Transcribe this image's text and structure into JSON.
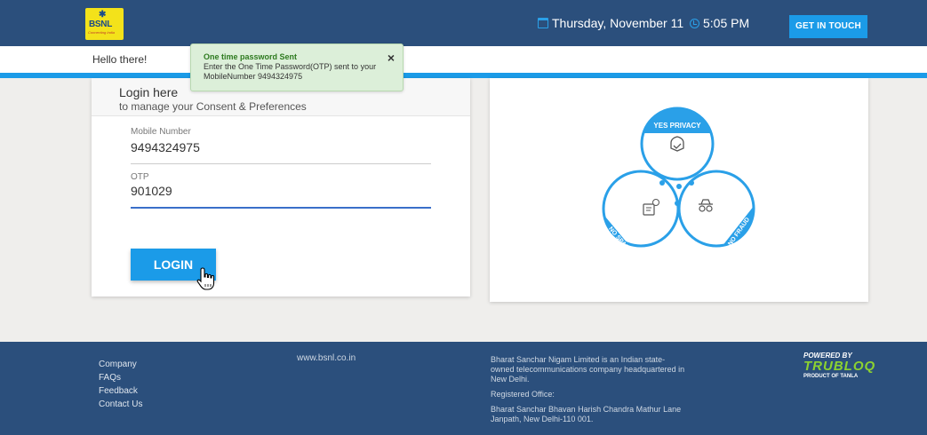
{
  "header": {
    "brand": "BSNL",
    "brand_tagline": "Connecting India",
    "date": "Thursday, November 11",
    "time": "5:05 PM",
    "cta_label": "GET IN TOUCH"
  },
  "greeting": "Hello there!",
  "toast": {
    "title": "One time password Sent",
    "message": "Enter the One Time Password(OTP) sent to your MobileNumber 9494324975",
    "close": "×"
  },
  "login": {
    "title": "Login here",
    "subtitle": "to manage your Consent & Preferences",
    "mobile_label": "Mobile Number",
    "mobile_value": "9494324975",
    "otp_label": "OTP",
    "otp_value": "901029",
    "button": "LOGIN"
  },
  "illustration": {
    "privacy": "YES PRIVACY",
    "spam": "NO SPAM",
    "fraud": "NO FRAUD"
  },
  "footer": {
    "links": [
      "Company",
      "FAQs",
      "Feedback",
      "Contact Us"
    ],
    "website": "www.bsnl.co.in",
    "about": "Bharat Sanchar Nigam Limited is an Indian state-owned telecommunications company headquartered in New Delhi.",
    "registered_label": "Registered Office:",
    "address": "Bharat Sanchar Bhavan Harish Chandra Mathur Lane Janpath, New Delhi-110 001.",
    "powered_by": "POWERED BY",
    "powered_brand": "TRUBLOQ",
    "powered_tagline": "PRODUCT OF TANLA"
  },
  "colors": {
    "header_bg": "#2b4f7c",
    "accent": "#1b9be8",
    "toast_bg": "#dcefd9"
  }
}
